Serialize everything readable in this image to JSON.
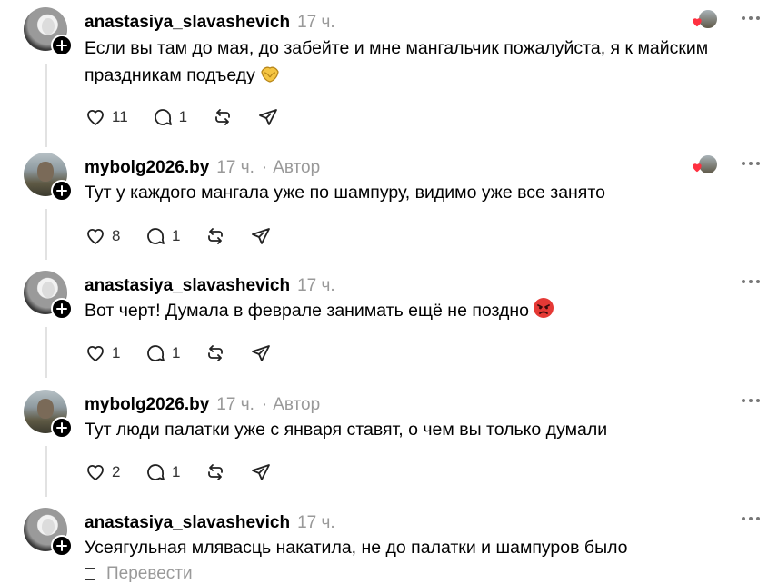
{
  "colors": {
    "text": "#000000",
    "muted": "#999999",
    "divider": "#e2e2e2",
    "like_heart": "#ff3040"
  },
  "icons": {
    "like": "heart-outline-icon",
    "reply": "speech-bubble-icon",
    "repost": "repost-arrows-icon",
    "share": "paper-plane-icon",
    "more": "ellipsis-icon",
    "follow": "plus-icon"
  },
  "posts": [
    {
      "username": "anastasiya_slavashevich",
      "time": "17 ч.",
      "author_badge": "",
      "text": "Если вы там до мая, до забейте и мне мангальчик пожалуйста, я к майским праздникам подъеду",
      "emoji": "pleading-hands-emoji",
      "likes": "11",
      "replies": "1",
      "liked_by_author": true
    },
    {
      "username": "mybolg2026.by",
      "time": "17 ч.",
      "author_badge": "Автор",
      "text": "Тут у каждого мангала уже по шампуру, видимо уже все занято",
      "emoji": "",
      "likes": "8",
      "replies": "1",
      "liked_by_author": true
    },
    {
      "username": "anastasiya_slavashevich",
      "time": "17 ч.",
      "author_badge": "",
      "text": "Вот черт! Думала в феврале занимать ещё не поздно",
      "emoji": "angry-face-emoji",
      "likes": "1",
      "replies": "1",
      "liked_by_author": false
    },
    {
      "username": "mybolg2026.by",
      "time": "17 ч.",
      "author_badge": "Автор",
      "text": "Тут люди палатки уже с января ставят, о чем вы только думали",
      "emoji": "",
      "likes": "2",
      "replies": "1",
      "liked_by_author": false
    },
    {
      "username": "anastasiya_slavashevich",
      "time": "17 ч.",
      "author_badge": "",
      "text": "Усеягульная млявасць накатила, не до палатки и шампуров было",
      "emoji": "",
      "translate_label": "Перевести"
    }
  ]
}
